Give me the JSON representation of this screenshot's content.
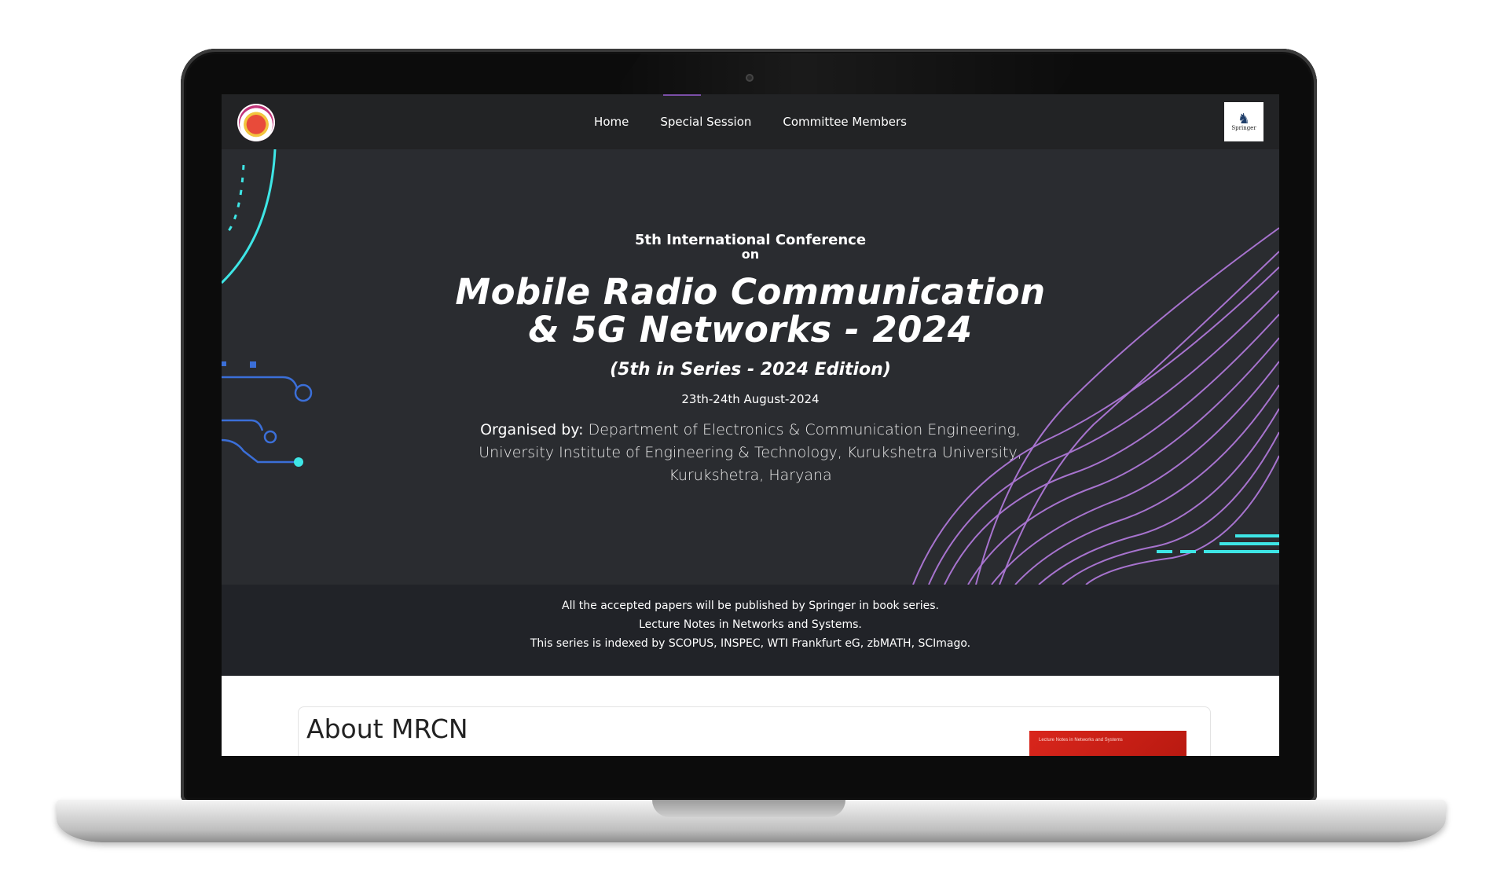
{
  "nav": {
    "items": [
      {
        "label": "Home"
      },
      {
        "label": "Special Session"
      },
      {
        "label": "Committee Members"
      }
    ],
    "right_logo_text": "Springer"
  },
  "hero": {
    "pre_title": "5th International Conference",
    "pre_on": "on",
    "title_line1": "Mobile Radio Communication",
    "title_line2": "& 5G Networks - 2024",
    "edition": "(5th in Series - 2024 Edition)",
    "dates": "23th-24th August-2024",
    "organised_label": "Organised by:",
    "organised_text": "Department of Electronics & Communication Engineering, University Institute of Engineering & Technology, Kurukshetra University, Kurukshetra, Haryana"
  },
  "publish": {
    "line1": "All the accepted papers will be published by Springer in book series.",
    "line2": "Lecture Notes in Networks and Systems.",
    "line3": "This series is indexed by SCOPUS, INSPEC, WTI Frankfurt eG, zbMATH, SCImago."
  },
  "about": {
    "title": "About MRCN",
    "book_cover_text": "Lecture Notes in Networks and Systems"
  },
  "colors": {
    "nav_bg": "#222325",
    "hero_bg": "#2a2c30",
    "band_bg": "#212328",
    "accent_cyan": "#3ee6e6",
    "accent_purple": "#b57be0",
    "circuit_blue": "#3b6fd8"
  }
}
